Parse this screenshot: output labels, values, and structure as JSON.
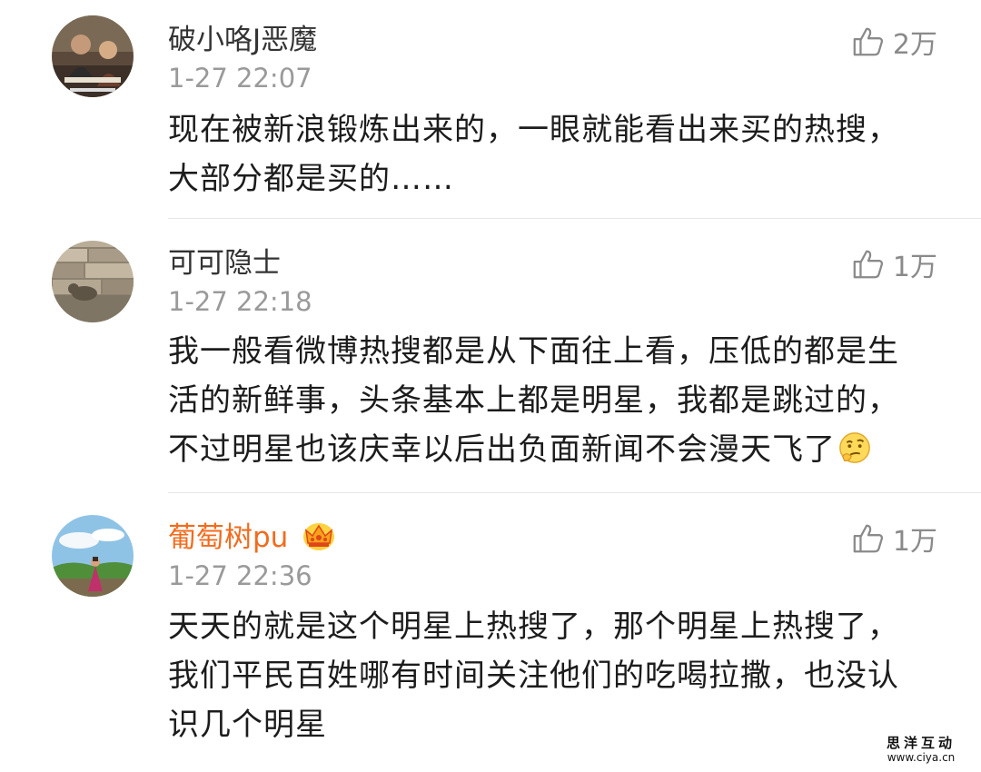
{
  "comments": [
    {
      "username": "破小咯J恶魔",
      "time": "1-27 22:07",
      "likes": "2万",
      "avatar_icon": "photo-avatar-people",
      "lines": [
        "现在被新浪锻炼出来的，一眼就能看出来买的热搜，",
        "大部分都是买的……"
      ]
    },
    {
      "username": "可可隐士",
      "time": "1-27 22:18",
      "likes": "1万",
      "avatar_icon": "photo-avatar-stone-wall",
      "lines": [
        "我一般看微博热搜都是从下面往上看，压低的都是生",
        "活的新鲜事，头条基本上都是明星，我都是跳过的，",
        "不过明星也该庆幸以后出负面新闻不会漫天飞了"
      ],
      "trailing_emoji": "thinking-emoji"
    },
    {
      "username": "葡萄树pu",
      "time": "1-27 22:36",
      "likes": "1万",
      "avatar_icon": "photo-avatar-landscape-girl",
      "badge_icon": "vip-crown-icon",
      "lines": [
        "天天的就是这个明星上热搜了，那个明星上热搜了，",
        "我们平民百姓哪有时间关注他们的吃喝拉撒，也没认",
        "识几个明星"
      ]
    }
  ],
  "watermark": {
    "title": "思洋互动",
    "url": "www.ciya.cn"
  },
  "colors": {
    "username": "#333333",
    "vip_username": "#f26b1d",
    "time": "#9a9a9a",
    "content": "#1c1c1c",
    "like": "#8a8a8a"
  }
}
